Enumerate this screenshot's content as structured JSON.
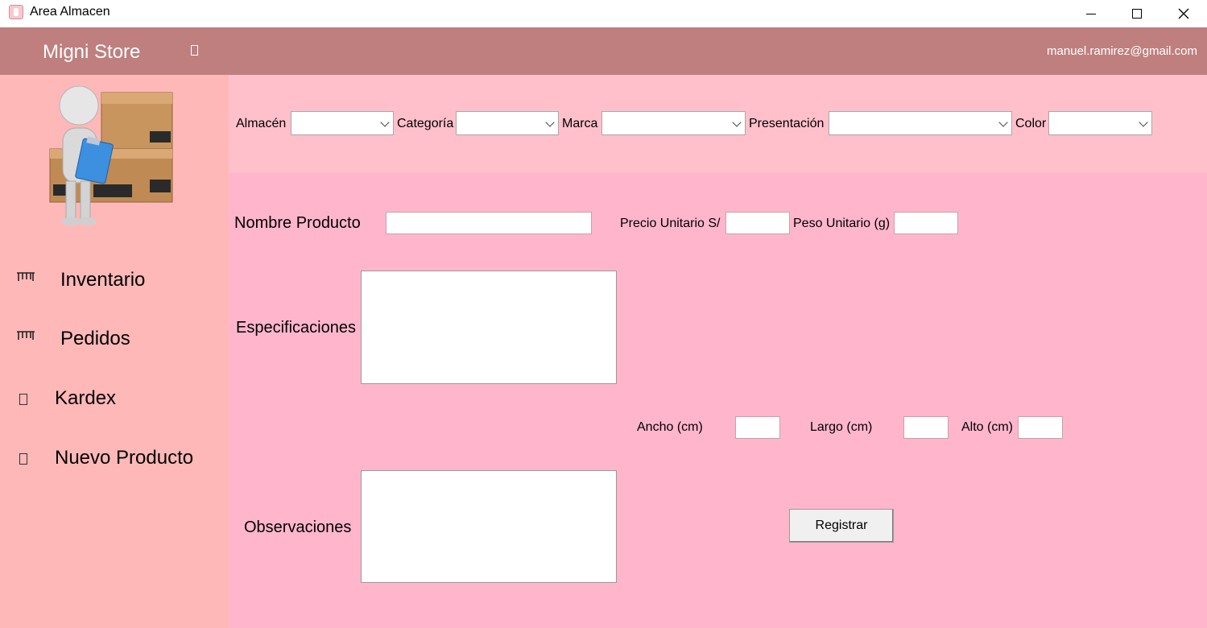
{
  "window": {
    "title": "Area Almacen"
  },
  "header": {
    "brand": "Migni Store",
    "user_email": "manuel.ramirez@gmail.com",
    "bg_color": "#bf7f7f"
  },
  "sidebar": {
    "bg_color": "#ffb8b8",
    "items": [
      {
        "label": "Inventario",
        "icon": "inventory-icon"
      },
      {
        "label": "Pedidos",
        "icon": "orders-icon"
      },
      {
        "label": "Kardex",
        "icon": "kardex-icon"
      },
      {
        "label": "Nuevo Producto",
        "icon": "new-product-icon"
      }
    ]
  },
  "filters": {
    "almacen_label": "Almacén",
    "categoria_label": "Categoría",
    "marca_label": "Marca",
    "presentacion_label": "Presentación",
    "color_label": "Color"
  },
  "form": {
    "nombre_label": "Nombre Producto",
    "precio_label": "Precio Unitario S/",
    "peso_label": "Peso Unitario (g)",
    "especificaciones_label": "Especificaciones",
    "ancho_label": "Ancho (cm)",
    "largo_label": "Largo (cm)",
    "alto_label": "Alto (cm)",
    "observaciones_label": "Observaciones",
    "registrar_label": "Registrar"
  }
}
